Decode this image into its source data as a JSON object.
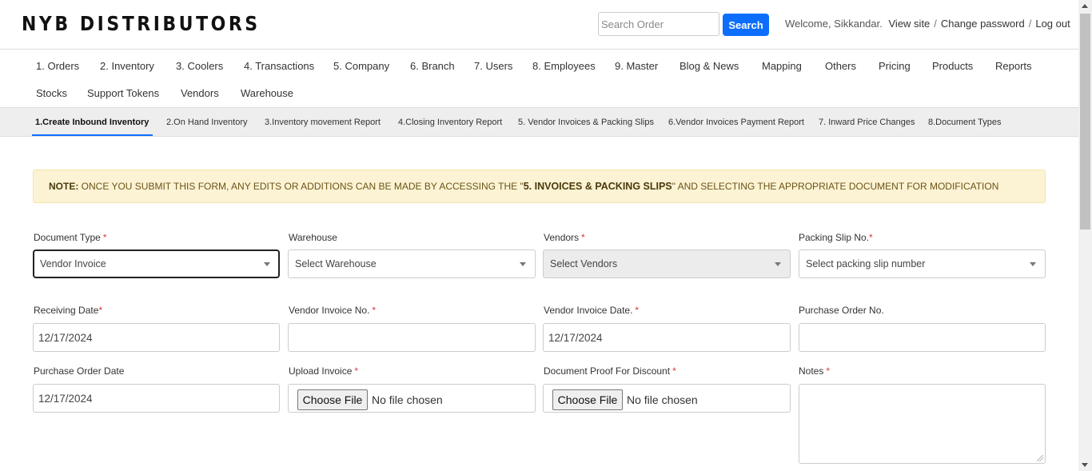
{
  "header": {
    "brand": "NYB DISTRIBUTORS",
    "search_placeholder": "Search Order",
    "search_button": "Search",
    "welcome": "Welcome, Sikkandar.",
    "view_site": "View site",
    "change_password": "Change password",
    "log_out": "Log out",
    "separator": "/"
  },
  "mainnav": {
    "items": [
      "1. Orders",
      "2. Inventory",
      "3. Coolers",
      "4. Transactions",
      "5. Company",
      "6. Branch",
      "7. Users",
      "8. Employees",
      "9. Master",
      "Blog & News",
      "Mapping",
      "Others",
      "Pricing",
      "Products",
      "Reports",
      "Stocks",
      "Support Tokens",
      "Vendors",
      "Warehouse"
    ]
  },
  "subnav": {
    "items": [
      "1.Create Inbound Inventory",
      "2.On Hand Inventory",
      "3.Inventory movement Report",
      "4.Closing Inventory Report",
      "5. Vendor Invoices & Packing Slips",
      "6.Vendor Invoices Payment Report",
      "7. Inward Price Changes",
      "8.Document Types"
    ],
    "active_index": 0
  },
  "note": {
    "label": "NOTE:",
    "text_before": " ONCE YOU SUBMIT THIS FORM, ANY EDITS OR ADDITIONS CAN BE MADE BY ACCESSING THE \"",
    "link_text": "5. INVOICES & PACKING SLIPS",
    "text_after": "\" AND SELECTING THE APPROPRIATE DOCUMENT FOR MODIFICATION"
  },
  "form": {
    "required_mark": "*",
    "document_type": {
      "label": "Document Type",
      "value": "Vendor Invoice"
    },
    "warehouse": {
      "label": "Warehouse",
      "value": "Select Warehouse"
    },
    "vendors": {
      "label": "Vendors",
      "value": "Select Vendors"
    },
    "packing_slip": {
      "label": "Packing Slip No.",
      "value": "Select packing slip number"
    },
    "receiving_date": {
      "label": "Receiving Date",
      "value": "12/17/2024"
    },
    "vendor_invoice_no": {
      "label": "Vendor Invoice No.",
      "value": ""
    },
    "vendor_invoice_date": {
      "label": "Vendor Invoice Date.",
      "value": "12/17/2024"
    },
    "purchase_order_no": {
      "label": "Purchase Order No.",
      "value": ""
    },
    "purchase_order_date": {
      "label": "Purchase Order Date",
      "value": "12/17/2024"
    },
    "upload_invoice": {
      "label": "Upload Invoice",
      "button": "Choose File",
      "status": "No file chosen"
    },
    "discount_proof": {
      "label": "Document Proof For Discount",
      "button": "Choose File",
      "status": "No file chosen"
    },
    "notes": {
      "label": "Notes",
      "value": ""
    }
  },
  "colors": {
    "primary": "#0d6efd",
    "note_bg": "#fcf3d4",
    "required": "#dc3545",
    "subnav_bg": "#eeeeee"
  }
}
